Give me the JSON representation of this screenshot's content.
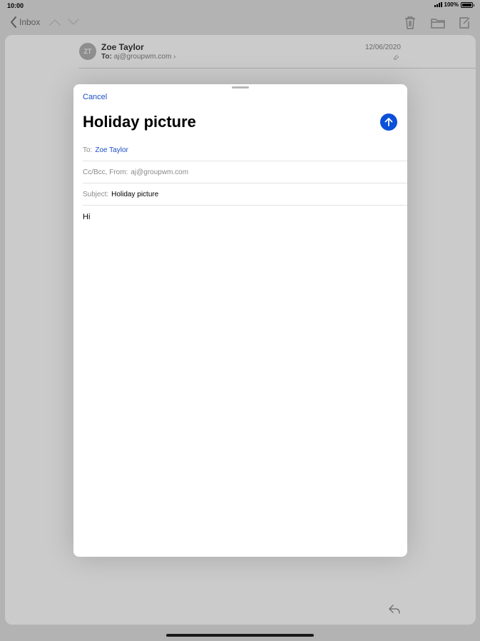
{
  "status_bar": {
    "time": "10:00",
    "battery_text": "100%"
  },
  "toolbar": {
    "back_label": "Inbox"
  },
  "message": {
    "avatar_initials": "ZT",
    "sender_name": "Zoe Taylor",
    "to_label": "To:",
    "to_address": "aj@groupwm.com",
    "date": "12/06/2020"
  },
  "compose": {
    "cancel_label": "Cancel",
    "title": "Holiday picture",
    "to_label": "To:",
    "to_value": "Zoe Taylor",
    "ccbcc_label": "Cc/Bcc, From:",
    "from_value": "aj@groupwm.com",
    "subject_label": "Subject:",
    "subject_value": "Holiday picture",
    "body": "Hi"
  },
  "colors": {
    "accent": "#1a4fc4",
    "send_button": "#0a50d8",
    "backdrop": "#b3b3b3"
  },
  "icons": [
    "back-chevron-icon",
    "up-arrow-icon",
    "down-arrow-icon",
    "trash-icon",
    "folder-icon",
    "compose-icon",
    "attachment-icon",
    "reply-icon",
    "send-arrow-icon"
  ]
}
